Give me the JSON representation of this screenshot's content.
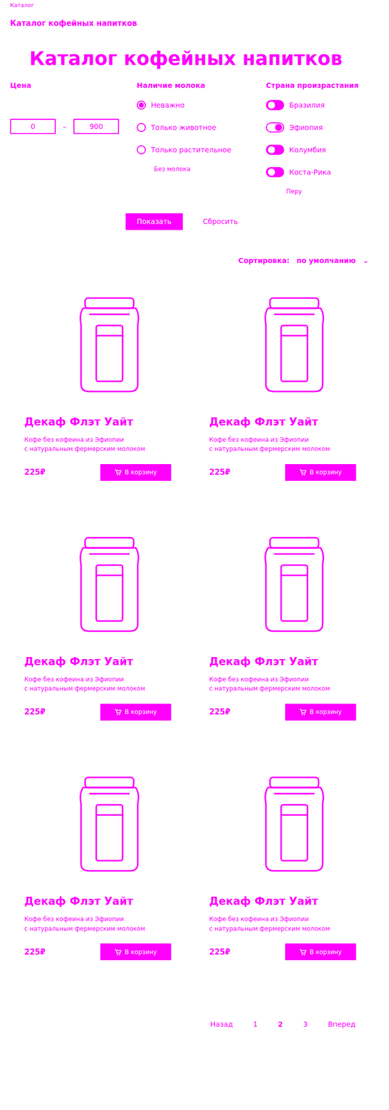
{
  "breadcrumb": "Каталог",
  "page_title": "Каталог кофейных напитков",
  "heading": "Каталог кофейных напитков",
  "filters": {
    "price": {
      "label": "Цена",
      "from": "0",
      "dash": "–",
      "to": "900"
    },
    "milk": {
      "label": "Наличие молока",
      "options": [
        {
          "label": "Неважно",
          "selected": true
        },
        {
          "label": "Только животное",
          "selected": false
        },
        {
          "label": "Только растительное",
          "selected": false
        }
      ],
      "extra": "Без молока"
    },
    "country": {
      "label": "Страна произрастания",
      "options": [
        {
          "label": "Бразилия",
          "on": true
        },
        {
          "label": "Эфиопия",
          "on": false
        },
        {
          "label": "Колумбия",
          "on": true
        },
        {
          "label": "Коста-Рика",
          "on": true
        }
      ],
      "extra": "Перу"
    },
    "apply": "Показать",
    "reset": "Сбросить"
  },
  "sort": {
    "label": "Сортировка:",
    "value": "по умолчанию",
    "arrow": "⌄"
  },
  "products": [
    {
      "title": "Декаф Флэт Уайт",
      "description_lines": [
        "Кофе без кофеина из Эфиопии",
        "с натуральным фермерским молоком"
      ],
      "price": "225₽",
      "button": "В корзину"
    },
    {
      "title": "Декаф Флэт Уайт",
      "description_lines": [
        "Кофе без кофеина из Эфиопии",
        "с натуральным фермерским молоком"
      ],
      "price": "225₽",
      "button": "В корзину"
    },
    {
      "title": "Декаф Флэт Уайт",
      "description_lines": [
        "Кофе без кофеина из Эфиопии",
        "с натуральным фермерским молоком"
      ],
      "price": "225₽",
      "button": "В корзину"
    },
    {
      "title": "Декаф Флэт Уайт",
      "description_lines": [
        "Кофе без кофеина из Эфиопии",
        "с натуральным фермерским молоком"
      ],
      "price": "225₽",
      "button": "В корзину"
    },
    {
      "title": "Декаф Флэт Уайт",
      "description_lines": [
        "Кофе без кофеина из Эфиопии",
        "с натуральным фермерским молоком"
      ],
      "price": "225₽",
      "button": "В корзину"
    },
    {
      "title": "Декаф Флэт Уайт",
      "description_lines": [
        "Кофе без кофеина из Эфиопии",
        "с натуральным фермерским молоком"
      ],
      "price": "225₽",
      "button": "В корзину"
    }
  ],
  "pagination": {
    "prev": "Назад",
    "pages": [
      {
        "label": "1",
        "selected": false
      },
      {
        "label": "2",
        "selected": true
      },
      {
        "label": "3",
        "selected": false
      }
    ],
    "next": "Вперед"
  }
}
